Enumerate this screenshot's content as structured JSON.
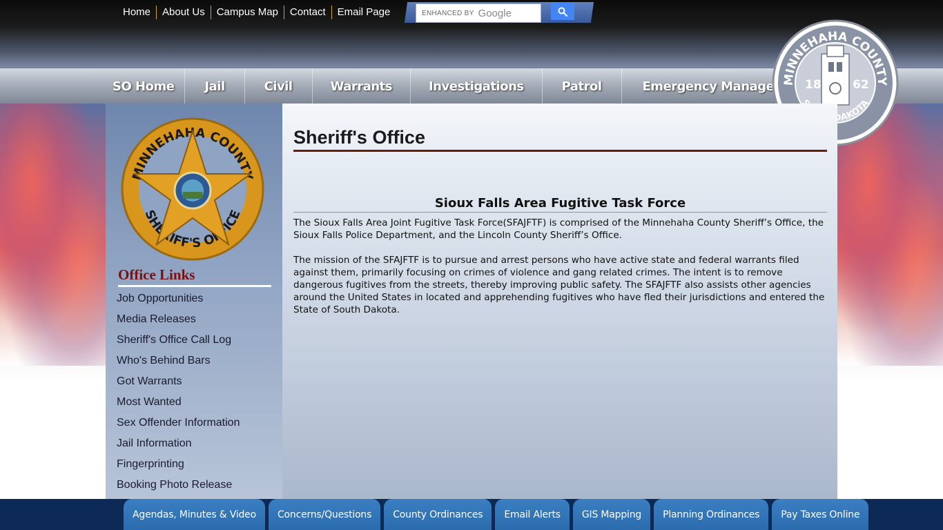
{
  "utility_nav": [
    "Home",
    "About Us",
    "Campus Map",
    "Contact",
    "Email Page"
  ],
  "search": {
    "enhanced_label": "ENHANCED BY",
    "provider": "Google",
    "button_icon": "search-icon"
  },
  "main_nav": [
    "SO Home",
    "Jail",
    "Civil",
    "Warrants",
    "Investigations",
    "Patrol",
    "Emergency Management"
  ],
  "seal": {
    "top_text": "MINNEHAHA COUNTY",
    "year_left": "18",
    "year_right": "62",
    "bottom_text": "SOUTH DAKOTA"
  },
  "badge": {
    "top_text": "MINNEHAHA COUNTY",
    "bottom_text": "SHERIFF'S OFFICE"
  },
  "sidebar": {
    "title": "Office Links",
    "links": [
      "Job Opportunities",
      "Media Releases",
      "Sheriff's Office Call Log",
      "Who's Behind Bars",
      "Got Warrants",
      "Most Wanted",
      "Sex Offender Information",
      "Jail Information",
      "Fingerprinting",
      "Booking Photo Release"
    ]
  },
  "content": {
    "page_title": "Sheriff's Office",
    "section_title": "Sioux Falls Area Fugitive Task Force",
    "paragraphs": [
      "The Sioux Falls Area Joint Fugitive Task Force(SFAJFTF) is comprised of the Minnehaha County Sheriff’s Office, the Sioux Falls Police Department, and the Lincoln County Sheriff’s Office.",
      "The mission of the SFAJFTF is to pursue and arrest persons who have active state and federal warrants filed against them, primarily focusing on crimes of violence and gang related crimes.  The intent is to remove dangerous fugitives from the streets, thereby improving public safety.  The SFAJFTF also assists other agencies around the United States in located and apprehending fugitives who have fled their jurisdictions and entered the State of South Dakota."
    ]
  },
  "quick_links": [
    "Agendas, Minutes & Video",
    "Concerns/Questions",
    "County Ordinances",
    "Email Alerts",
    "GIS Mapping",
    "Planning Ordinances",
    "Pay Taxes Online"
  ],
  "colors": {
    "header_dark": "#0b0b0b",
    "accent_red": "#7a1010",
    "badge_gold": "#d9961c",
    "bottom_bar": "#0c2a55",
    "quick_link_blue": "#2f74b8",
    "search_button": "#4285f4"
  }
}
